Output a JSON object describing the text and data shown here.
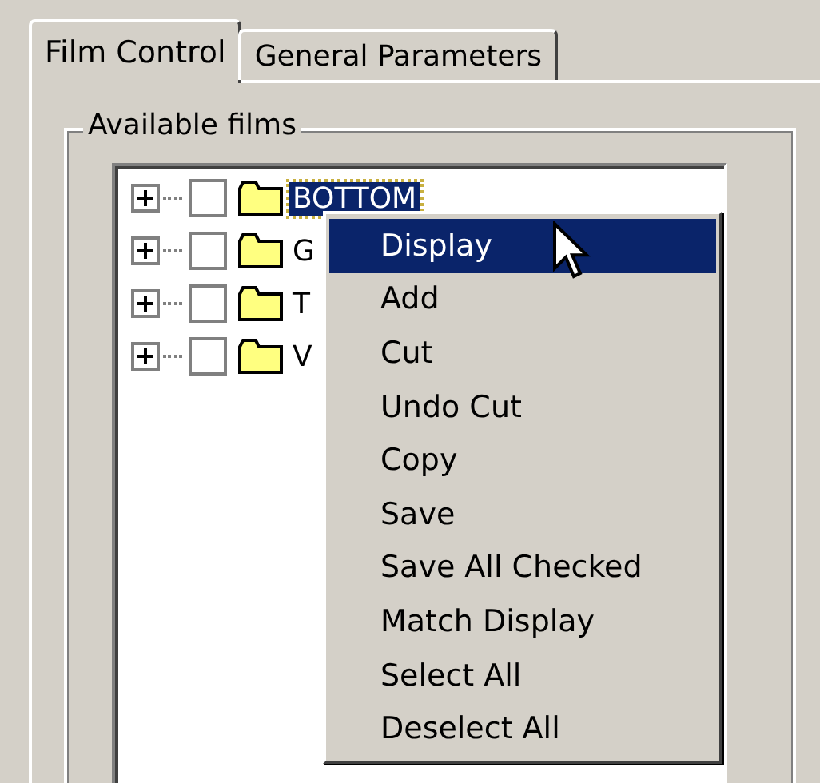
{
  "tabs": [
    {
      "label": "Film Control",
      "selected": true
    },
    {
      "label": "General Parameters",
      "selected": false
    }
  ],
  "group": {
    "title": "Available films"
  },
  "tree": {
    "items": [
      {
        "label": "BOTTOM",
        "checked": false,
        "expanded": false,
        "selected": true
      },
      {
        "label": "G",
        "checked": false,
        "expanded": false,
        "selected": false
      },
      {
        "label": "T",
        "checked": false,
        "expanded": false,
        "selected": false
      },
      {
        "label": "V",
        "checked": false,
        "expanded": false,
        "selected": false
      }
    ]
  },
  "context_menu": {
    "items": [
      {
        "label": "Display",
        "selected": true
      },
      {
        "label": "Add",
        "selected": false
      },
      {
        "label": "Cut",
        "selected": false
      },
      {
        "label": "Undo Cut",
        "selected": false
      },
      {
        "label": "Copy",
        "selected": false
      },
      {
        "label": "Save",
        "selected": false
      },
      {
        "label": "Save All Checked",
        "selected": false
      },
      {
        "label": "Match Display",
        "selected": false
      },
      {
        "label": "Select All",
        "selected": false
      },
      {
        "label": "Deselect All",
        "selected": false
      }
    ]
  }
}
